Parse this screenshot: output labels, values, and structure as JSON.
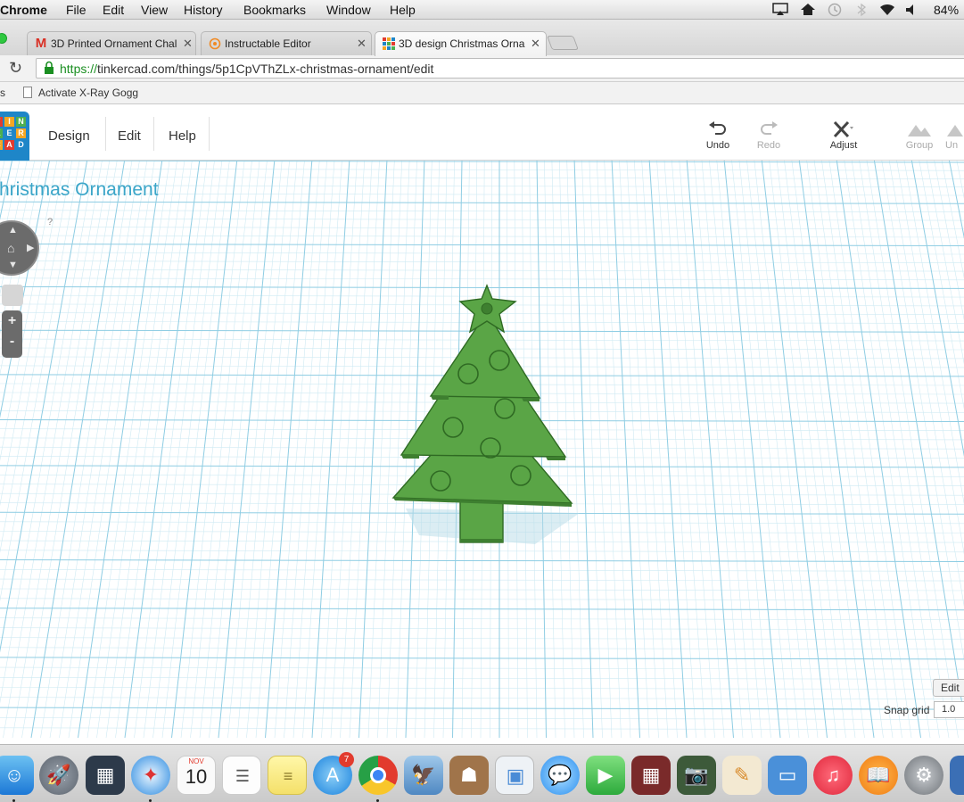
{
  "menubar": {
    "app_name": "Chrome",
    "menus": [
      "File",
      "Edit",
      "View",
      "History",
      "Bookmarks",
      "Window",
      "Help"
    ],
    "battery": "84% ("
  },
  "tabs": [
    {
      "title": "3D Printed Ornament Chal",
      "favicon": "gmail-icon"
    },
    {
      "title": "Instructable Editor",
      "favicon": "instructables-icon"
    },
    {
      "title": "3D design Christmas Orna",
      "favicon": "tinkercad-icon"
    }
  ],
  "addressbar": {
    "url_scheme": "https://",
    "url_host": "tinkercad.com",
    "url_path": "/things/5p1CpVThZLx-christmas-ornament/edit"
  },
  "bookmarks": {
    "first": "s",
    "item": "Activate X-Ray Gogg"
  },
  "app": {
    "logo_letters": [
      "T",
      "I",
      "N",
      "K",
      "E",
      "R",
      "C",
      "A",
      "D"
    ],
    "nav": [
      "Design",
      "Edit",
      "Help"
    ],
    "toolbar": {
      "undo": "Undo",
      "redo": "Redo",
      "adjust": "Adjust",
      "group": "Group",
      "ungroup": "Un"
    }
  },
  "workplane": {
    "design_title": "hristmas Ornament",
    "help_mark": "?",
    "zoom_in": "+",
    "zoom_out": "-",
    "edit_grid": "Edit",
    "snap_grid_label": "Snap grid",
    "snap_grid_value": "1.0"
  },
  "dock": {
    "calendar_month": "NOV",
    "calendar_day": "10",
    "appstore_badge": "7"
  },
  "colors": {
    "tree_green": "#5aa546",
    "grid_line": "#9fd3e6",
    "title_blue": "#3aa5c8"
  }
}
